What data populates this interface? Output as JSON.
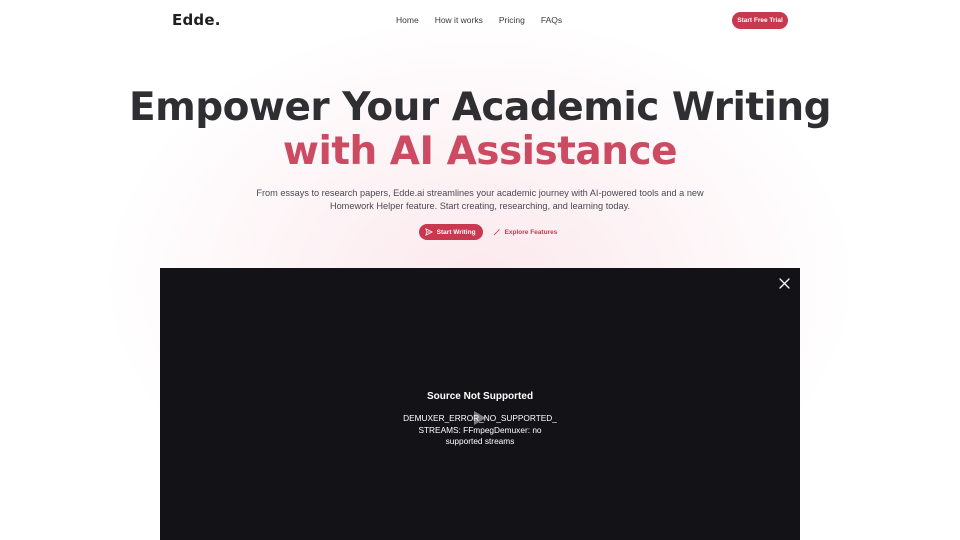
{
  "nav": {
    "logo": "Edde.",
    "links": [
      "Home",
      "How it works",
      "Pricing",
      "FAQs"
    ],
    "cta_label": "Start Free Trial"
  },
  "hero": {
    "headline": "Empower Your Academic Writing",
    "headline_accent": "with AI Assistance",
    "subtext": "From essays to research papers, Edde.ai streamlines your academic journey with AI-powered tools and a new Homework Helper feature. Start creating, researching, and learning today.",
    "primary_button": "Start Writing",
    "secondary_button": "Explore Features"
  },
  "video": {
    "error_title": "Source Not Supported",
    "error_message": "DEMUXER_ERROR_NO_SUPPORTED_ STREAMS: FFmpegDemuxer: no supported streams"
  },
  "icons": {
    "primary_button_icon": "send-icon",
    "secondary_button_icon": "wand-icon",
    "close": "close-icon",
    "play": "play-icon"
  },
  "colors": {
    "accent": "#c8384f",
    "headline_accent": "#cc4a62",
    "video_bg": "#131317"
  }
}
